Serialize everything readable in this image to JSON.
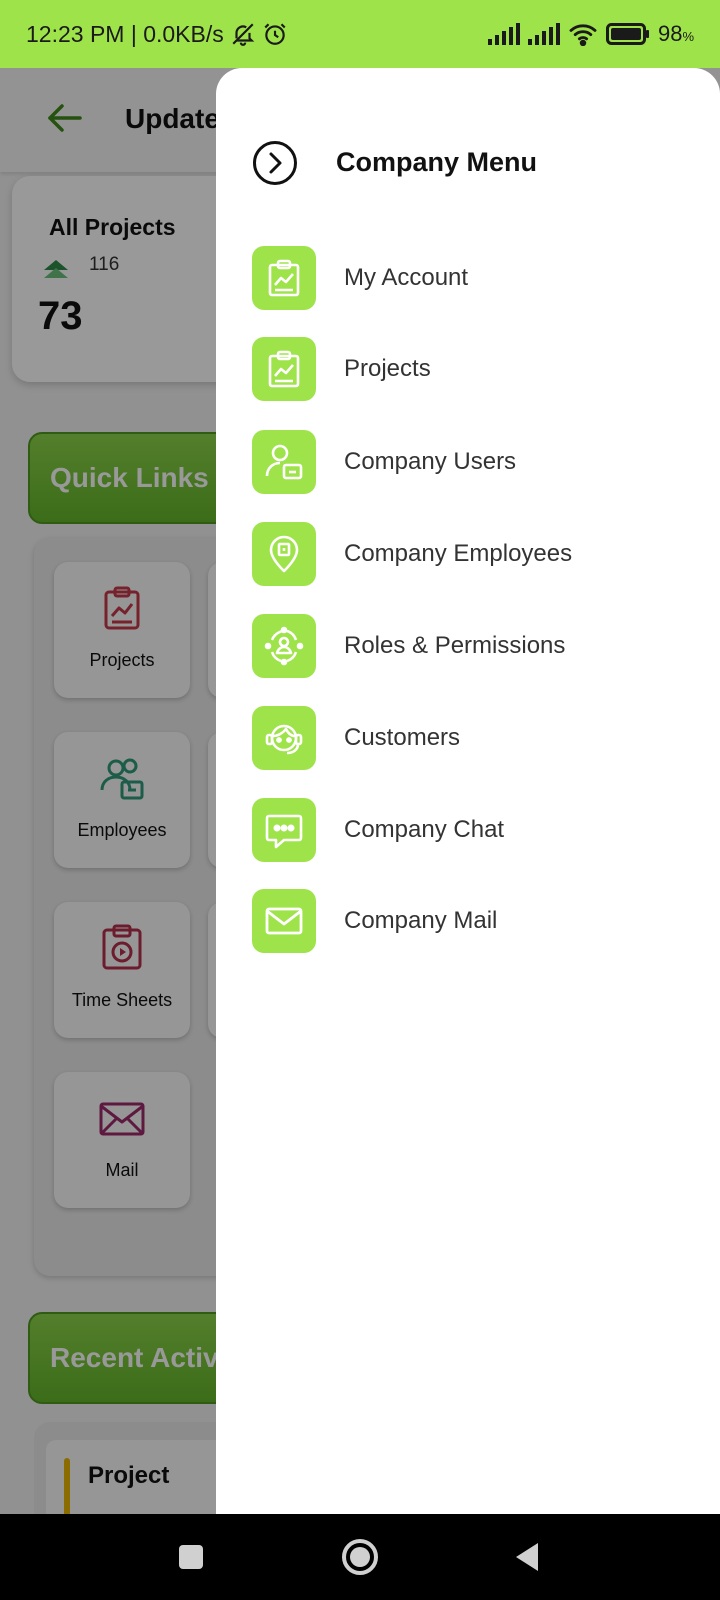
{
  "status_bar": {
    "time_speed": "12:23 PM | 0.0KB/s",
    "battery_value": "98",
    "battery_unit": "%",
    "icons": [
      "bell-off-icon",
      "alarm-icon",
      "signal-icon",
      "signal-icon",
      "wifi-icon",
      "battery-icon"
    ],
    "bg_color": "#9fe34a"
  },
  "app": {
    "title": "Update",
    "stat_card": {
      "title": "All Projects",
      "sub_value": "116",
      "value": "73"
    },
    "quick_links_label": "Quick Links",
    "tiles": [
      {
        "label": "Projects",
        "icon": "clipboard-chart-icon",
        "color": "#c43a4a"
      },
      {
        "label": "Employees",
        "icon": "users-icon",
        "color": "#2f9a7a"
      },
      {
        "label": "Time Sheets",
        "icon": "timesheet-icon",
        "color": "#b4304c"
      },
      {
        "label": "Mail",
        "icon": "mail-icon",
        "color": "#9c2a6a"
      }
    ],
    "recent_label": "Recent Activity",
    "recent_item_title": "Project"
  },
  "drawer": {
    "title": "Company Menu",
    "accent_color": "#9fe34a",
    "items": [
      {
        "label": "My Account",
        "icon": "clipboard-chart-icon"
      },
      {
        "label": "Projects",
        "icon": "clipboard-chart-icon"
      },
      {
        "label": "Company Users",
        "icon": "user-card-icon"
      },
      {
        "label": "Company Employees",
        "icon": "location-pin-icon"
      },
      {
        "label": "Roles & Permissions",
        "icon": "user-cycle-icon"
      },
      {
        "label": "Customers",
        "icon": "headset-icon"
      },
      {
        "label": "Company Chat",
        "icon": "chat-icon"
      },
      {
        "label": "Company Mail",
        "icon": "mail-icon"
      }
    ]
  },
  "nav_bar": {
    "buttons": [
      "recents-button",
      "home-button",
      "back-button"
    ]
  }
}
